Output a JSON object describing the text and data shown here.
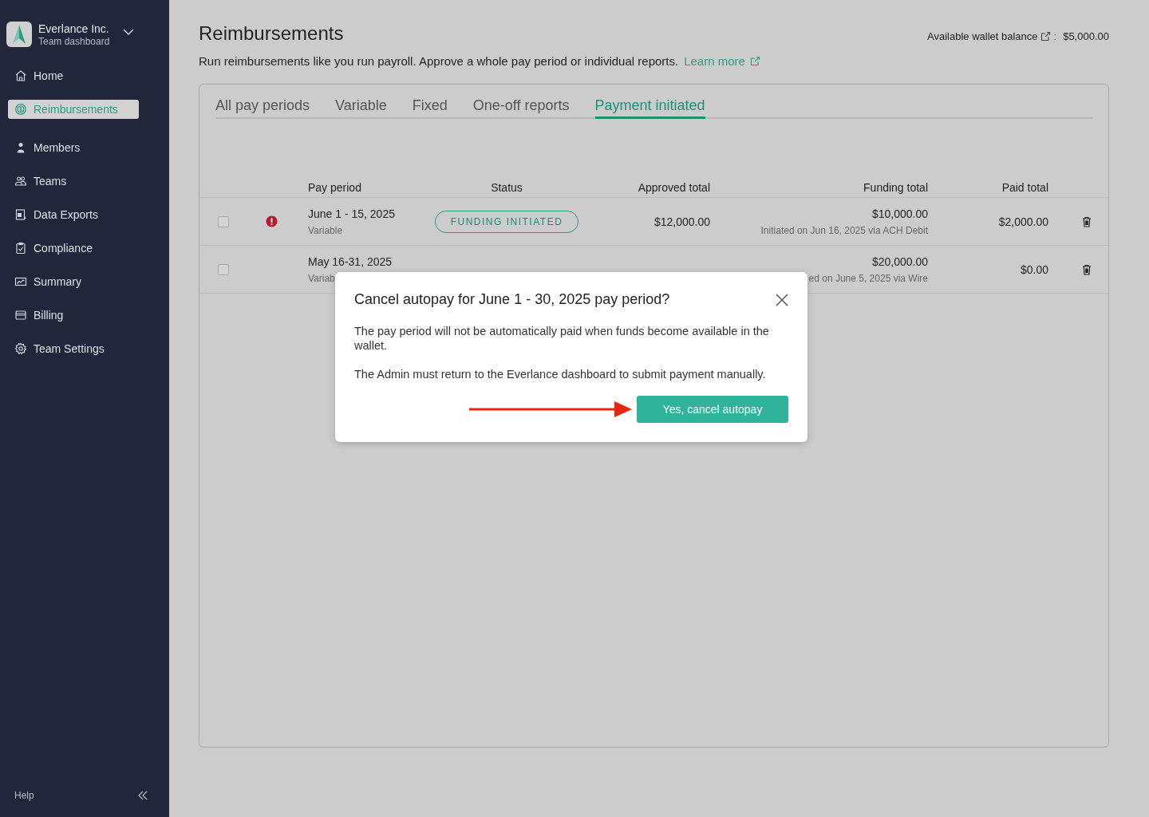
{
  "sidebar": {
    "org_name": "Everlance Inc.",
    "org_subtitle": "Team dashboard",
    "items": [
      {
        "kind": "home",
        "label": "Home",
        "selected": false
      },
      {
        "kind": "reimbursements",
        "label": "Reimbursements",
        "selected": true
      },
      {
        "kind": "members",
        "label": "Members",
        "selected": false
      },
      {
        "kind": "teams",
        "label": "Teams",
        "selected": false
      },
      {
        "kind": "exports",
        "label": "Data Exports",
        "selected": false
      },
      {
        "kind": "compliance",
        "label": "Compliance",
        "selected": false
      },
      {
        "kind": "summary",
        "label": "Summary",
        "selected": false
      },
      {
        "kind": "billing",
        "label": "Billing",
        "selected": false
      },
      {
        "kind": "settings",
        "label": "Team Settings",
        "selected": false
      }
    ],
    "help": "Help"
  },
  "header": {
    "title": "Reimbursements",
    "wallet_label": "Available wallet balance",
    "wallet_sep": ":",
    "wallet_amount": "$5,000.00",
    "description": "Run reimbursements like you run payroll.  Approve a whole pay period or individual reports.",
    "learn_more": "Learn more"
  },
  "tabs": [
    {
      "label": "All pay periods",
      "selected": false
    },
    {
      "label": "Variable",
      "selected": false
    },
    {
      "label": "Fixed",
      "selected": false
    },
    {
      "label": "One-off reports",
      "selected": false
    },
    {
      "label": "Payment initiated",
      "selected": true
    }
  ],
  "table": {
    "columns": [
      "Pay period",
      "Status",
      "Approved  total",
      "Funding total",
      "Paid total"
    ],
    "rows": [
      {
        "checked": false,
        "alert": true,
        "pay_period": "June 1 - 15, 2025",
        "type": "Variable",
        "status": "FUNDING INITIATED",
        "approved_total": "$12,000.00",
        "funding_total": "$10,000.00",
        "funding_note": "Initiated on Jun 16, 2025 via ACH Debit",
        "paid_total": "$2,000.00"
      },
      {
        "checked": false,
        "alert": false,
        "pay_period": "May 16-31, 2025",
        "type": "Variab",
        "funding_total": "$20,000.00",
        "funding_note": "ed on June 5, 2025 via Wire",
        "paid_total": "$0.00"
      }
    ]
  },
  "dialog": {
    "title": "Cancel autopay for June 1 - 30, 2025 pay period?",
    "paragraphs": [
      "The pay period will not be automatically paid when funds become available in the wallet.",
      "The Admin must return to the Everlance dashboard to submit payment manually."
    ],
    "confirm": "Yes, cancel autopay"
  }
}
